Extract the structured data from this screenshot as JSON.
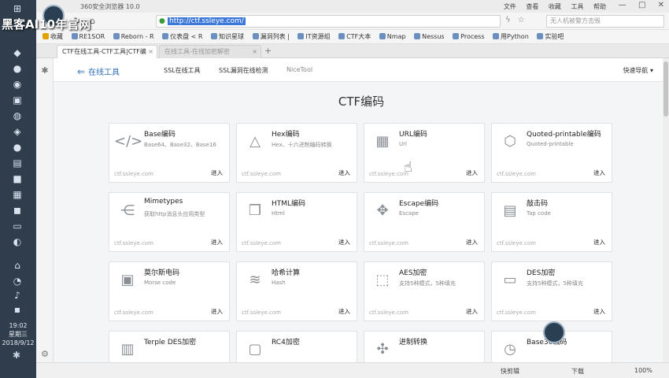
{
  "overlay": {
    "taskbar_text": "黑客AI10年官网"
  },
  "clock": {
    "time": "19:02",
    "weekday": "星期三",
    "date": "2018/9/12"
  },
  "browser": {
    "app_title": "360安全浏览器 10.0",
    "menu": [
      "文件",
      "查看",
      "收藏",
      "工具",
      "帮助"
    ],
    "url": "http://ctf.ssleye.com/",
    "search_placeholder": "无人机被警方击毁",
    "bookmarks": [
      "收藏",
      "RE1SOR",
      "Reborn - R",
      "仪表盘 < R",
      "知识星球",
      "漏洞列表 |",
      "IT资源组",
      "CTF大本",
      "Nmap",
      "Nessus",
      "Process",
      "用Python",
      "实验吧"
    ],
    "tabs": [
      {
        "label": "CTF在线工具-CTF工具|CTF编"
      },
      {
        "label": "在线工具-在线加密解密"
      }
    ]
  },
  "site": {
    "logo": "在线工具",
    "nav": [
      "SSL在线工具",
      "SSL漏洞在线检测",
      "NiceTool"
    ],
    "quick_nav": "快速导航",
    "title": "CTF编码"
  },
  "cards": [
    {
      "name": "Base编码",
      "desc": "Base64、Base32、Base16",
      "icon": "code-icon",
      "domain": "ctf.ssleye.com",
      "enter": "进入"
    },
    {
      "name": "Hex编码",
      "desc": "Hex、十六进制编码转换",
      "icon": "network-icon",
      "domain": "ctf.ssleye.com",
      "enter": "进入"
    },
    {
      "name": "URL编码",
      "desc": "Url",
      "icon": "shapes-icon",
      "domain": "ctf.ssleye.com",
      "enter": "进入"
    },
    {
      "name": "Quoted-printable编码",
      "desc": "Quoted-printable",
      "icon": "hexagons-icon",
      "domain": "ctf.ssleye.com",
      "enter": "进入"
    },
    {
      "name": "Mimetypes",
      "desc": "获取http消息头应用类型",
      "icon": "share-icon",
      "domain": "ctf.ssleye.com",
      "enter": "进入"
    },
    {
      "name": "HTML编码",
      "desc": "Html",
      "icon": "cubes-icon",
      "domain": "ctf.ssleye.com",
      "enter": "进入"
    },
    {
      "name": "Escape编码",
      "desc": "Escape",
      "icon": "arrows-icon",
      "domain": "ctf.ssleye.com",
      "enter": "进入"
    },
    {
      "name": "敲击码",
      "desc": "Tap code",
      "icon": "server-icon",
      "domain": "ctf.ssleye.com",
      "enter": "进入"
    },
    {
      "name": "莫尔斯电码",
      "desc": "Morse code",
      "icon": "chip-icon",
      "domain": "ctf.ssleye.com",
      "enter": "进入"
    },
    {
      "name": "哈希计算",
      "desc": "Hash",
      "icon": "layers-icon",
      "domain": "ctf.ssleye.com",
      "enter": "进入"
    },
    {
      "name": "AES加密",
      "desc": "支持5种模式，5种填充",
      "icon": "box-icon",
      "domain": "ctf.ssleye.com",
      "enter": "进入"
    },
    {
      "name": "DES加密",
      "desc": "支持5种模式，5种填充",
      "icon": "monitor-icon",
      "domain": "ctf.ssleye.com",
      "enter": "进入"
    },
    {
      "name": "Terple DES加密",
      "desc": "",
      "icon": "table-icon",
      "domain": "",
      "enter": ""
    },
    {
      "name": "RC4加密",
      "desc": "",
      "icon": "briefcase-icon",
      "domain": "",
      "enter": ""
    },
    {
      "name": "进制转换",
      "desc": "",
      "icon": "gamepad-icon",
      "domain": "",
      "enter": ""
    },
    {
      "name": "Base36编码",
      "desc": "",
      "icon": "clock-icon",
      "domain": "",
      "enter": ""
    }
  ],
  "status": {
    "speed": "快剪辑",
    "download": "下载",
    "zoom": "100%"
  },
  "colors": {
    "accent": "#2d6db5",
    "url_selection": "#3b78d8",
    "taskbar": "#2f3d4c"
  }
}
